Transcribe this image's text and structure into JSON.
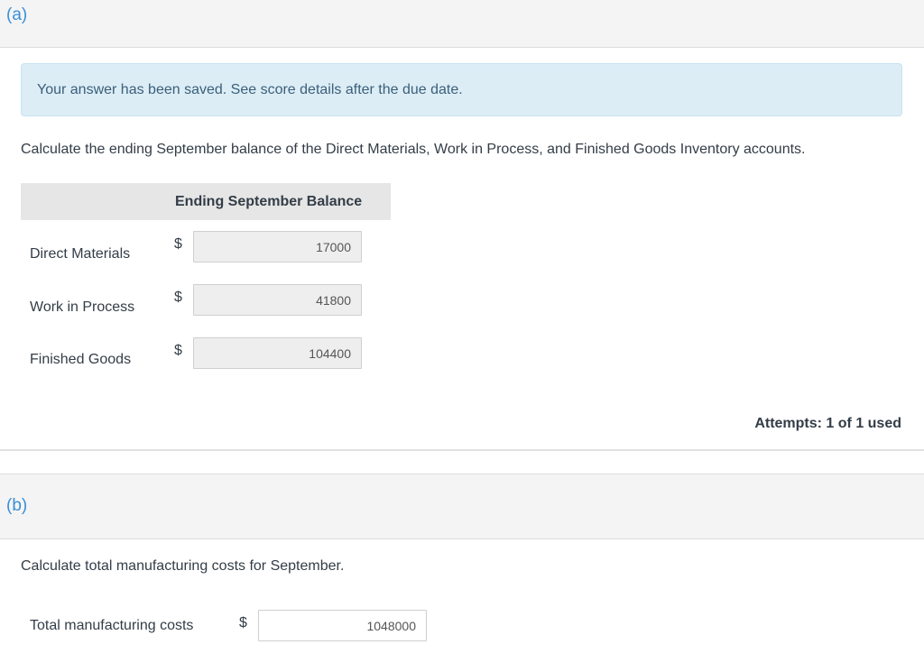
{
  "part_a": {
    "label": "(a)",
    "notice": "Your answer has been saved. See score details after the due date.",
    "prompt": "Calculate the ending September balance of the Direct Materials, Work in Process, and Finished Goods Inventory accounts.",
    "table": {
      "column_header": "Ending September Balance",
      "rows": [
        {
          "label": "Direct Materials",
          "currency": "$",
          "value": "17000"
        },
        {
          "label": "Work in Process",
          "currency": "$",
          "value": "41800"
        },
        {
          "label": "Finished Goods",
          "currency": "$",
          "value": "104400"
        }
      ]
    },
    "attempts": "Attempts: 1 of 1 used"
  },
  "part_b": {
    "label": "(b)",
    "prompt": "Calculate total manufacturing costs for September.",
    "field": {
      "label": "Total manufacturing costs",
      "currency": "$",
      "value": "1048000"
    }
  },
  "colors": {
    "part_label": "#3a8fd8",
    "notice_bg": "#dcedf5",
    "notice_text": "#3b5f7c",
    "header_bg": "#f4f4f4"
  }
}
